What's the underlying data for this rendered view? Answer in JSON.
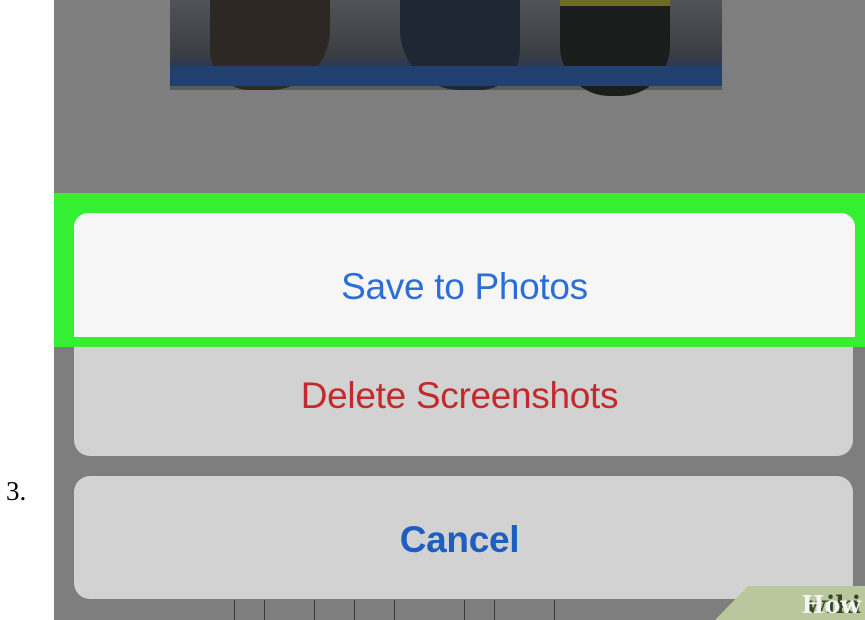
{
  "step": {
    "number": "3."
  },
  "action_sheet": {
    "save_label": "Save to Photos",
    "delete_label": "Delete Screenshots",
    "cancel_label": "Cancel"
  },
  "highlight": {
    "color": "#35ef33"
  },
  "colors": {
    "save_text": "#2b6fd6",
    "delete_text": "#c22b2b",
    "cancel_text": "#1d5ec0",
    "dimmed_background": "#7e7e7e"
  },
  "watermark": {
    "part1": "wiki",
    "part2": "How"
  }
}
